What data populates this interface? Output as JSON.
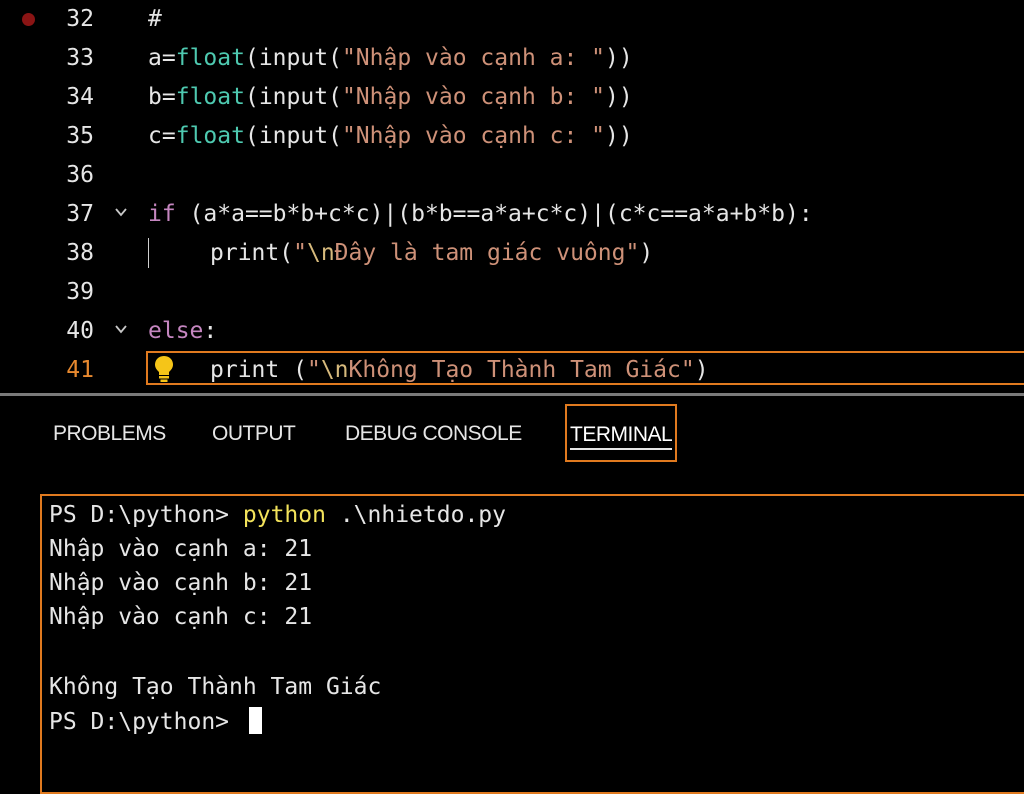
{
  "editor": {
    "lines": [
      {
        "num": "32",
        "parts": {
          "c1": "#"
        }
      },
      {
        "num": "33",
        "parts": {
          "v": "a",
          "op": "=",
          "fn": "float",
          "p1": "(",
          "fn2": "input",
          "p2": "(",
          "str": "\"Nhập vào cạnh a: \"",
          "p3": "))"
        }
      },
      {
        "num": "34",
        "parts": {
          "v": "b",
          "op": "=",
          "fn": "float",
          "p1": "(",
          "fn2": "input",
          "p2": "(",
          "str": "\"Nhập vào cạnh b: \"",
          "p3": "))"
        }
      },
      {
        "num": "35",
        "parts": {
          "v": "c",
          "op": "=",
          "fn": "float",
          "p1": "(",
          "fn2": "input",
          "p2": "(",
          "str": "\"Nhập vào cạnh c: \"",
          "p3": "))"
        }
      },
      {
        "num": "36",
        "parts": {}
      },
      {
        "num": "37",
        "parts": {
          "kw": "if",
          "rest": " (a*a==b*b+c*c)|(b*b==a*a+c*c)|(c*c==a*a+b*b):"
        }
      },
      {
        "num": "38",
        "parts": {
          "fn": "print",
          "p1": "(",
          "q": "\"",
          "esc": "\\n",
          "str": "Đây là tam giác vuông\"",
          "p2": ")"
        }
      },
      {
        "num": "39",
        "parts": {}
      },
      {
        "num": "40",
        "parts": {
          "kw": "else",
          "rest": ":"
        }
      },
      {
        "num": "41",
        "parts": {
          "fn": "print",
          "p1": " (",
          "q": "\"",
          "esc": "\\n",
          "str": "Không Tạo Thành Tam Giác\"",
          "p2": ")"
        }
      }
    ]
  },
  "panel": {
    "tabs": [
      "PROBLEMS",
      "OUTPUT",
      "DEBUG CONSOLE",
      "TERMINAL"
    ],
    "active_tab": "TERMINAL"
  },
  "terminal": {
    "prompt": "PS D:\\python> ",
    "command": "python",
    "command_args": " .\\nhietdo.py",
    "output": [
      "Nhập vào cạnh a: 21",
      "Nhập vào cạnh b: 21",
      "Nhập vào cạnh c: 21",
      "",
      "Không Tạo Thành Tam Giác"
    ],
    "final_prompt": "PS D:\\python> "
  },
  "colors": {
    "background": "#000000",
    "keyword": "#c586c0",
    "function": "#4ec9b0",
    "string": "#ce9178",
    "escape": "#d7ba7d",
    "focus_border": "#e07a1f",
    "command": "#f3e35b",
    "breakpoint": "#8a1414"
  }
}
